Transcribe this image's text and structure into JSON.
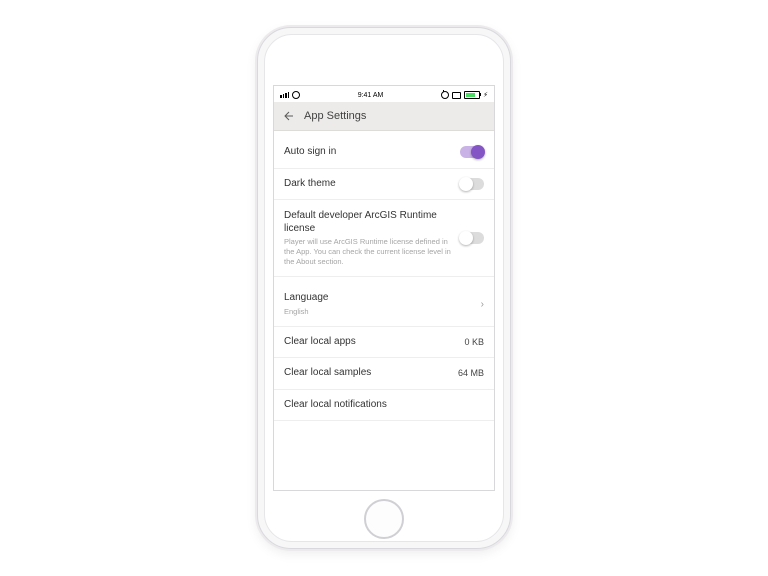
{
  "status": {
    "time": "9:41 AM"
  },
  "nav": {
    "title": "App Settings"
  },
  "rows": {
    "autoSignIn": {
      "label": "Auto sign in",
      "on": true
    },
    "darkTheme": {
      "label": "Dark theme",
      "on": false
    },
    "license": {
      "label": "Default developer ArcGIS Runtime license",
      "sub": "Player will use ArcGIS Runtime license defined in the App. You can check the current license level in the About section.",
      "on": false
    },
    "language": {
      "label": "Language",
      "sub": "English"
    },
    "clearApps": {
      "label": "Clear local apps",
      "value": "0 KB"
    },
    "clearSamples": {
      "label": "Clear local samples",
      "value": "64 MB"
    },
    "clearNotifs": {
      "label": "Clear local notifications"
    }
  },
  "colors": {
    "accent": "#8455c5",
    "accentTrack": "#c9b2e6"
  }
}
